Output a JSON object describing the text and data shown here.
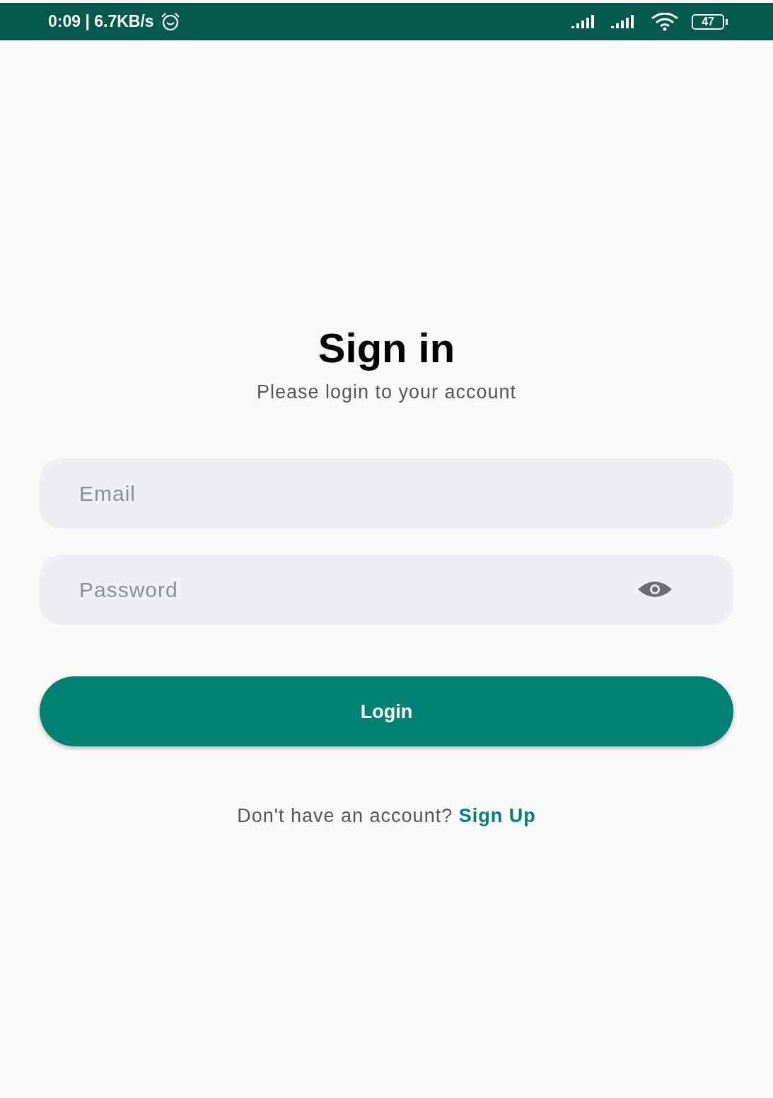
{
  "status_bar": {
    "time": "0:09 | 6.7KB/s",
    "battery": "47"
  },
  "title": "Sign in",
  "subtitle": "Please login to your account",
  "fields": [
    {
      "kind": "text",
      "placeholder": "Email"
    },
    {
      "kind": "password",
      "placeholder": "Password"
    }
  ],
  "login_button": "Login",
  "signup_prompt": "Don't have an account?",
  "signup_link": "Sign Up"
}
